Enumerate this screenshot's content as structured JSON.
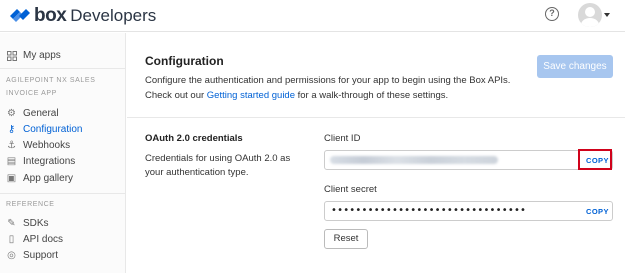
{
  "header": {
    "logo_brand": "box",
    "logo_product": "Developers",
    "help_symbol": "?",
    "help_icon": "question-circle-icon",
    "avatar_icon": "user-avatar-icon"
  },
  "sidebar": {
    "my_apps": {
      "label": "My apps",
      "icon": "grid-icon"
    },
    "app_org": "AGILEPOINT NX SALES",
    "app_name": "INVOICE APP",
    "app_items": [
      {
        "label": "General",
        "icon": "gear-icon",
        "glyph": "⚙",
        "active": false
      },
      {
        "label": "Configuration",
        "icon": "key-icon",
        "glyph": "⚷",
        "active": true
      },
      {
        "label": "Webhooks",
        "icon": "webhook-icon",
        "glyph": "⚓",
        "active": false
      },
      {
        "label": "Integrations",
        "icon": "integrations-icon",
        "glyph": "▤",
        "active": false
      },
      {
        "label": "App gallery",
        "icon": "gallery-icon",
        "glyph": "▣",
        "active": false
      }
    ],
    "reference_label": "REFERENCE",
    "reference_items": [
      {
        "label": "SDKs",
        "icon": "wrench-icon",
        "glyph": "✎"
      },
      {
        "label": "API docs",
        "icon": "book-icon",
        "glyph": "▯"
      },
      {
        "label": "Support",
        "icon": "lifebuoy-icon",
        "glyph": "◎"
      }
    ]
  },
  "main": {
    "title": "Configuration",
    "description_prefix": "Configure the authentication and permissions for your app to begin using the Box APIs. Check out our ",
    "description_link": "Getting started guide",
    "description_suffix": " for a walk-through of these settings.",
    "save_button": "Save changes",
    "oauth_title": "OAuth 2.0 credentials",
    "oauth_description": "Credentials for using OAuth 2.0 as your authentication type.",
    "client_id_label": "Client ID",
    "client_id_copy": "COPY",
    "client_secret_label": "Client secret",
    "client_secret_value": "••••••••••••••••••••••••••••••••",
    "client_secret_copy": "COPY",
    "reset_button": "Reset"
  },
  "colors": {
    "accent": "#0061d5",
    "save_disabled": "#a7c6ef",
    "highlight": "#d0021b"
  }
}
